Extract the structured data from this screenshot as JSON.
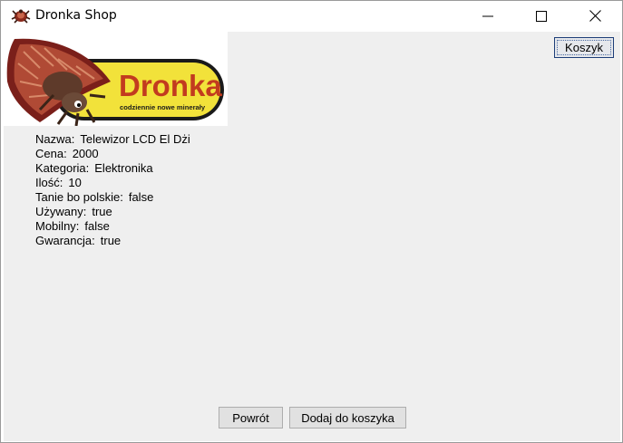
{
  "window": {
    "title": "Dronka Shop",
    "app_icon": "shield-beetle-icon",
    "controls": [
      "minimize-icon",
      "maximize-icon",
      "close-icon"
    ]
  },
  "logo": {
    "brand": "Dronka",
    "tagline": "codziennie nowe minerały",
    "colors": {
      "badge": "#f2e23a",
      "brand_text": "#c23b1f",
      "border": "#1a1a1a"
    }
  },
  "toolbar": {
    "cart_label": "Koszyk"
  },
  "product": [
    {
      "label": "Nazwa:",
      "value": "Telewizor LCD El Dżi"
    },
    {
      "label": "Cena:",
      "value": "2000"
    },
    {
      "label": "Kategoria:",
      "value": "Elektronika"
    },
    {
      "label": "Ilość:",
      "value": "10"
    },
    {
      "label": "Tanie bo polskie:",
      "value": "false"
    },
    {
      "label": "Używany:",
      "value": "true"
    },
    {
      "label": "Mobilny:",
      "value": "false"
    },
    {
      "label": "Gwarancja:",
      "value": "true"
    }
  ],
  "actions": {
    "back_label": "Powrót",
    "add_to_cart_label": "Dodaj do koszyka"
  }
}
